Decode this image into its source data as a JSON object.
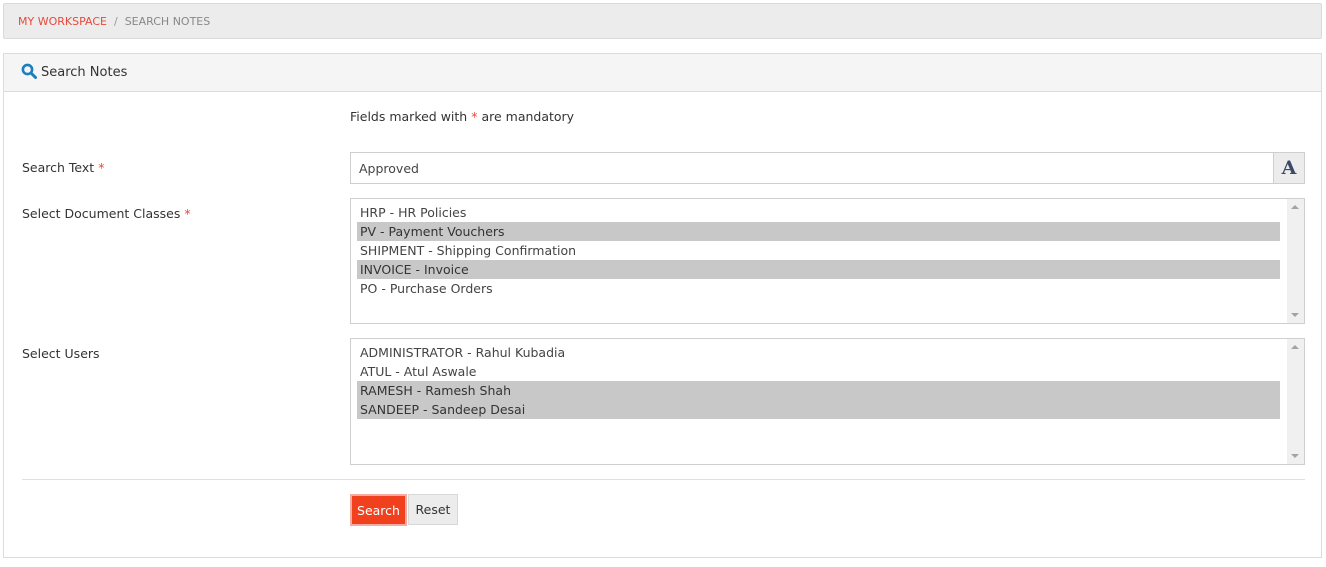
{
  "breadcrumb": {
    "root": "My Workspace",
    "separator": "/",
    "current": "Search Notes"
  },
  "panel": {
    "title": "Search Notes",
    "icon": "search-icon"
  },
  "form": {
    "mandatory_prefix": "Fields marked with",
    "mandatory_star": "*",
    "mandatory_suffix": "are mandatory",
    "search_text": {
      "label": "Search Text",
      "required": "*",
      "value": "Approved",
      "font_button": "A"
    },
    "document_classes": {
      "label": "Select Document Classes",
      "required": "*",
      "options": [
        {
          "label": "HRP - HR Policies",
          "selected": false
        },
        {
          "label": "PV - Payment Vouchers",
          "selected": true
        },
        {
          "label": "SHIPMENT - Shipping Confirmation",
          "selected": false
        },
        {
          "label": "INVOICE - Invoice",
          "selected": true
        },
        {
          "label": "PO - Purchase Orders",
          "selected": false
        }
      ]
    },
    "users": {
      "label": "Select Users",
      "options": [
        {
          "label": "ADMINISTRATOR - Rahul Kubadia",
          "selected": false
        },
        {
          "label": "ATUL - Atul Aswale",
          "selected": false
        },
        {
          "label": "RAMESH - Ramesh Shah",
          "selected": true
        },
        {
          "label": "SANDEEP - Sandeep Desai",
          "selected": true
        }
      ]
    },
    "buttons": {
      "search": "Search",
      "reset": "Reset"
    }
  },
  "colors": {
    "accent": "#f0401d",
    "link": "#e8483a",
    "icon": "#1a7fbf",
    "selected_option": "#c8c8c8"
  }
}
